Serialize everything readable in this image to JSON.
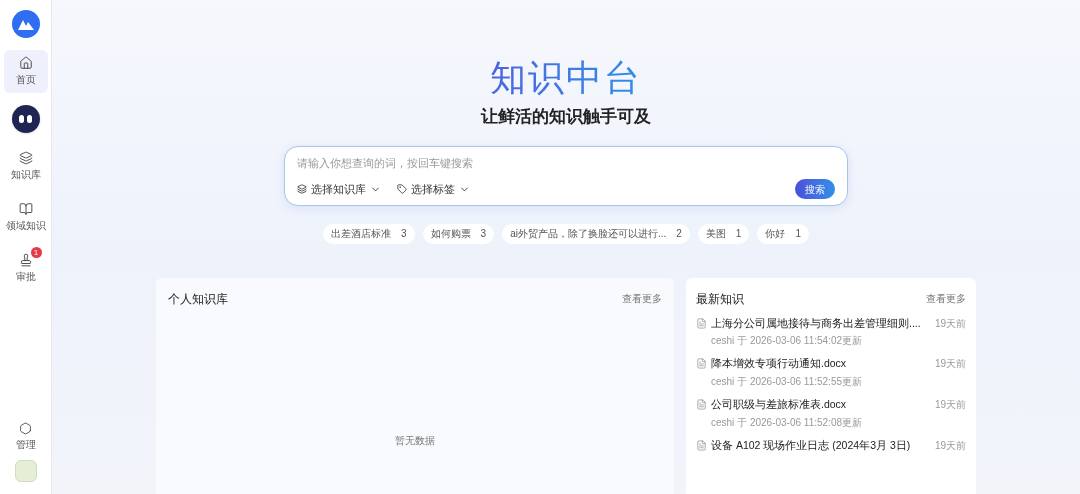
{
  "sidebar": {
    "items": [
      {
        "kind": "nav",
        "label": "首页",
        "selected": true
      },
      {
        "kind": "bot"
      },
      {
        "kind": "nav",
        "label": "知识库",
        "selected": false
      },
      {
        "kind": "nav",
        "label": "领域知识",
        "selected": false
      },
      {
        "kind": "nav",
        "label": "审批",
        "selected": false,
        "badge": "1"
      }
    ],
    "bottom": {
      "label": "管理"
    }
  },
  "hero": {
    "title": "知识中台",
    "subtitle": "让鲜活的知识触手可及"
  },
  "search": {
    "placeholder": "请输入你想查询的词，按回车键搜索",
    "filters": [
      "选择知识库",
      "选择标签"
    ],
    "button": "搜索"
  },
  "hot_tags": [
    {
      "label": "出差酒店标准",
      "count": "3"
    },
    {
      "label": "如何购票",
      "count": "3"
    },
    {
      "label": "ai外贸产品，除了换脸还可以进行...",
      "count": "2"
    },
    {
      "label": "美图",
      "count": "1"
    },
    {
      "label": "你好",
      "count": "1"
    }
  ],
  "personal": {
    "title": "个人知识库",
    "more": "查看更多",
    "empty": "暂无数据"
  },
  "latest": {
    "title": "最新知识",
    "more": "查看更多",
    "items": [
      {
        "name": "上海分公司属地接待与商务出差管理细则....",
        "meta": "ceshi 于 2026-03-06 11:54:02更新",
        "time": "19天前"
      },
      {
        "name": "降本增效专项行动通知.docx",
        "meta": "ceshi 于 2026-03-06 11:52:55更新",
        "time": "19天前"
      },
      {
        "name": "公司职级与差旅标准表.docx",
        "meta": "ceshi 于 2026-03-06 11:52:08更新",
        "time": "19天前"
      },
      {
        "name": "设备 A102 现场作业日志 (2024年3月 3日)",
        "time": "19天前"
      }
    ]
  }
}
